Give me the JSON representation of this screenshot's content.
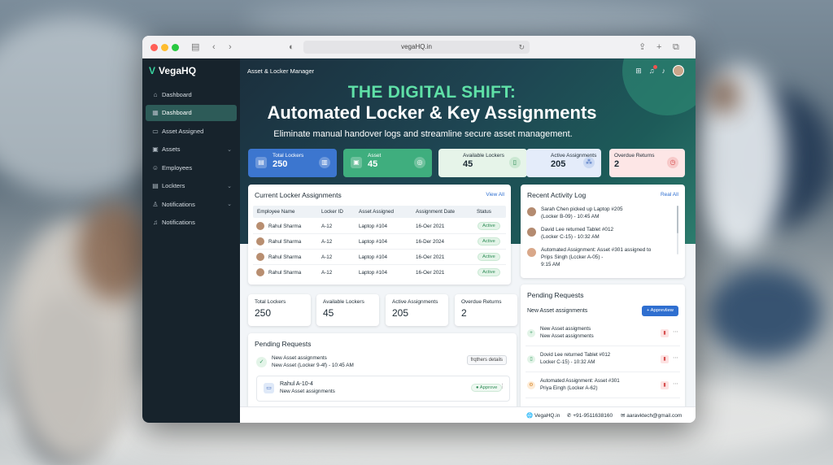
{
  "browser": {
    "url": "vegaHQ.in"
  },
  "brand": {
    "name": "VegaHQ"
  },
  "sidebar": {
    "items": [
      {
        "label": "Dashboard",
        "icon": "home-icon"
      },
      {
        "label": "Dashboard",
        "icon": "dashboard-icon",
        "active": true
      },
      {
        "label": "Asset Assigned",
        "icon": "clipboard-icon"
      },
      {
        "label": "Assets",
        "icon": "box-icon",
        "chevron": true
      },
      {
        "label": "Employees",
        "icon": "users-icon"
      },
      {
        "label": "Lockters",
        "icon": "lock-icon",
        "chevron": true
      },
      {
        "label": "Notifications",
        "icon": "user-bell-icon",
        "chevron": true
      },
      {
        "label": "Notifications",
        "icon": "bell-icon"
      }
    ]
  },
  "header": {
    "title": "Asset & Locker Manager"
  },
  "hero": {
    "line1": "THE DIGITAL SHIFT:",
    "line2": "Automated Locker & Key Assignments",
    "subtitle": "Eliminate manual handover logs and streamline secure asset management."
  },
  "stats": [
    {
      "label": "Total Lockers",
      "value": "250"
    },
    {
      "label": "Asset",
      "value": "45"
    },
    {
      "label": "Available Lockers",
      "value": "45"
    },
    {
      "label": "Active Assignments",
      "value": "205"
    },
    {
      "label": "Overdue Returns",
      "value": "2"
    }
  ],
  "assignments": {
    "title": "Current Locker Assignments",
    "link": "View All",
    "columns": [
      "Employee Name",
      "Locker ID",
      "Asset Assigned",
      "Assignment Date",
      "Status"
    ],
    "rows": [
      [
        "Rahul Sharma",
        "A-12",
        "Laptop #104",
        "16-Oer 2021",
        "Active"
      ],
      [
        "Rahul Sharma",
        "A-12",
        "Laptop #104",
        "16-Der 2024",
        "Active"
      ],
      [
        "Rahul Sharma",
        "A-12",
        "Laptop #104",
        "16-Oer 2021",
        "Active"
      ],
      [
        "Rahul Sharma",
        "A-12",
        "Laptop #104",
        "16-Oer 2021",
        "Active"
      ]
    ]
  },
  "activity": {
    "title": "Recent Activity Log",
    "link": "Real All",
    "items": [
      {
        "line1": "Sarah Chen picked up Laptop #205",
        "line2": "(Locker B-09) - 10:45 AM"
      },
      {
        "line1": "David Lee returned Tablet #012",
        "line2": "(Locker C-15) - 10:32 AM"
      },
      {
        "line1": "Automated Assignment: Asset #301 assigned to",
        "line2": "Prips Singh (Lccker A-05) -",
        "line3": "9:15 AM"
      }
    ]
  },
  "mini_stats": [
    {
      "label": "Total Lockers",
      "value": "250"
    },
    {
      "label": "Available Lockers",
      "value": "45"
    },
    {
      "label": "Active Assignments",
      "value": "205"
    },
    {
      "label": "Overdue Returns",
      "value": "2"
    }
  ],
  "pending_left": {
    "title": "Pending Requests",
    "item": {
      "title": "New Asset assignments",
      "sub": "New Asset (Locker 9-4f) - 10:45 AM",
      "button": "frqthers details"
    },
    "inner": {
      "title": "Rahul A-10-4",
      "sub": "New Asset assignments",
      "pill": "Approve"
    }
  },
  "pending_right": {
    "title": "Pending Requests",
    "subtitle": "New Asset assignments",
    "button": "+ Apprevliew",
    "items": [
      {
        "line1": "New Asset assigments",
        "line2": "New Asset assignments"
      },
      {
        "line1": "Dovid Lee returned Tablet #012",
        "line2": "Locker C-15) - 10:32 AM"
      },
      {
        "line1": "Automated Assignment: Asset #301",
        "line2": "Priya Eingh (Locker A-62)"
      }
    ]
  },
  "footer": {
    "site": "VegaHQ.in",
    "phone": "+91-9511638160",
    "email": "aaravktech@gmail.com"
  },
  "colors": {
    "accent_green": "#3fae7e",
    "accent_blue": "#3c76cf",
    "sidebar": "#17232c",
    "headline_green": "#5fe0a7"
  }
}
